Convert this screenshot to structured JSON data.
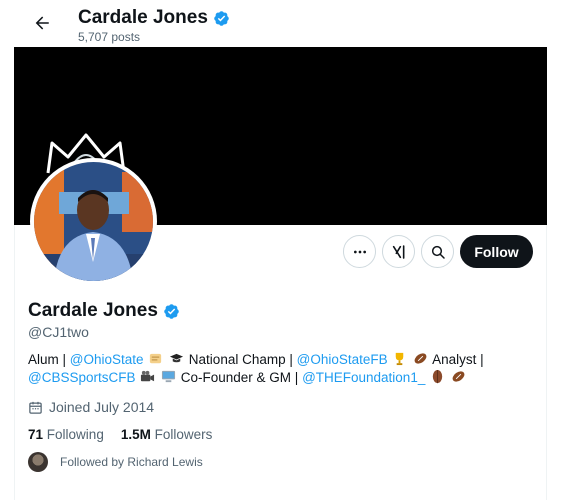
{
  "header": {
    "name": "Cardale Jones",
    "posts": "5,707 posts"
  },
  "profile": {
    "name": "Cardale Jones",
    "handle": "@CJ1two",
    "joined": "Joined July 2014",
    "following_count": "71",
    "following_label": "Following",
    "followers_count": "1.5M",
    "followers_label": "Followers",
    "followed_by": "Followed by Richard Lewis"
  },
  "bio": {
    "t1": "Alum | ",
    "l1": "@OhioState",
    "t2": " National Champ | ",
    "l2": "@OhioStateFB",
    "t3": " Analyst |",
    "l3": "@CBSSportsCFB",
    "t4": " Co-Founder & GM | ",
    "l4": "@THEFoundation1_"
  },
  "actions": {
    "follow_label": "Follow",
    "more_icon": "more-icon",
    "grok_icon": "grok-icon",
    "search_icon": "search-icon"
  },
  "colors": {
    "accent": "#1d9bf0",
    "banner": "#000000",
    "follow_button": "#0f1419",
    "muted_text": "#536471"
  }
}
